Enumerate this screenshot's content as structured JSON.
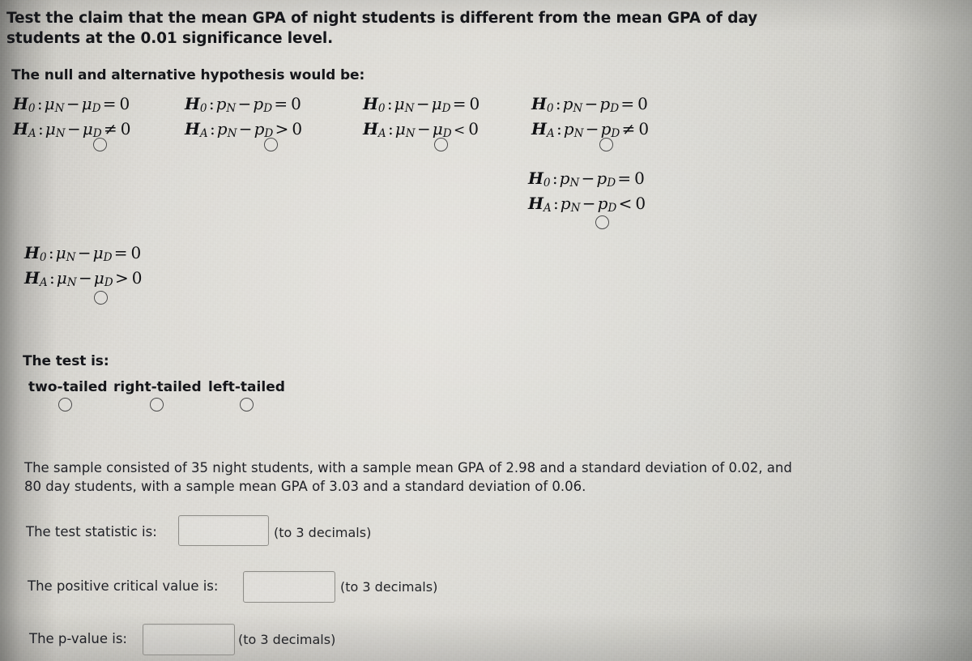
{
  "question": {
    "headline": "Test the claim that the mean GPA of night students is different from the mean GPA of day students at the 0.01 significance level.",
    "hypothesis_prompt": "The null and alternative hypothesis would be:"
  },
  "hypothesis_options": [
    {
      "id": "opt-1",
      "null_h": "H0 : μN − μD = 0",
      "alt_h": "HA : μN − μD ≠ 0",
      "null_left": "H",
      "null_sub": "0",
      "null_param_a": "μ",
      "null_sub_a": "N",
      "null_param_b": "μ",
      "null_sub_b": "D",
      "null_rel": "=",
      "null_value": "0",
      "alt_left": "H",
      "alt_sub": "A",
      "alt_param_a": "μ",
      "alt_sub_a": "N",
      "alt_param_b": "μ",
      "alt_sub_b": "D",
      "alt_rel": "≠",
      "alt_value": "0",
      "selected": false
    },
    {
      "id": "opt-2",
      "null_h": "H0 : pN − pD = 0",
      "alt_h": "HA : pN − pD > 0",
      "null_left": "H",
      "null_sub": "0",
      "null_param_a": "p",
      "null_sub_a": "N",
      "null_param_b": "p",
      "null_sub_b": "D",
      "null_rel": "=",
      "null_value": "0",
      "alt_left": "H",
      "alt_sub": "A",
      "alt_param_a": "p",
      "alt_sub_a": "N",
      "alt_param_b": "p",
      "alt_sub_b": "D",
      "alt_rel": ">",
      "alt_value": "0",
      "selected": false
    },
    {
      "id": "opt-3",
      "null_h": "H0 : μN − μD = 0",
      "alt_h": "HA : μN − μD < 0",
      "null_left": "H",
      "null_sub": "0",
      "null_param_a": "μ",
      "null_sub_a": "N",
      "null_param_b": "μ",
      "null_sub_b": "D",
      "null_rel": "=",
      "null_value": "0",
      "alt_left": "H",
      "alt_sub": "A",
      "alt_param_a": "μ",
      "alt_sub_a": "N",
      "alt_param_b": "μ",
      "alt_sub_b": "D",
      "alt_rel": "<",
      "alt_value": "0",
      "selected": false
    },
    {
      "id": "opt-4",
      "null_h": "H0 : pN − pD = 0",
      "alt_h": "HA : pN − pD ≠ 0",
      "null_left": "H",
      "null_sub": "0",
      "null_param_a": "p",
      "null_sub_a": "N",
      "null_param_b": "p",
      "null_sub_b": "D",
      "null_rel": "=",
      "null_value": "0",
      "alt_left": "H",
      "alt_sub": "A",
      "alt_param_a": "p",
      "alt_sub_a": "N",
      "alt_param_b": "p",
      "alt_sub_b": "D",
      "alt_rel": "≠",
      "alt_value": "0",
      "selected": false
    },
    {
      "id": "opt-5",
      "null_h": "H0 : pN − pD = 0",
      "alt_h": "HA : pN − pD < 0",
      "null_left": "H",
      "null_sub": "0",
      "null_param_a": "p",
      "null_sub_a": "N",
      "null_param_b": "p",
      "null_sub_b": "D",
      "null_rel": "=",
      "null_value": "0",
      "alt_left": "H",
      "alt_sub": "A",
      "alt_param_a": "p",
      "alt_sub_a": "N",
      "alt_param_b": "p",
      "alt_sub_b": "D",
      "alt_rel": "<",
      "alt_value": "0",
      "selected": false
    },
    {
      "id": "opt-6",
      "null_h": "H0 : μN − μD = 0",
      "alt_h": "HA : μN − μD > 0",
      "null_left": "H",
      "null_sub": "0",
      "null_param_a": "μ",
      "null_sub_a": "N",
      "null_param_b": "μ",
      "null_sub_b": "D",
      "null_rel": "=",
      "null_value": "0",
      "alt_left": "H",
      "alt_sub": "A",
      "alt_param_a": "μ",
      "alt_sub_a": "N",
      "alt_param_b": "μ",
      "alt_sub_b": "D",
      "alt_rel": ">",
      "alt_value": "0",
      "selected": false
    }
  ],
  "test_is": {
    "label": "The test is:",
    "options": [
      {
        "id": "two-tailed",
        "label": "two-tailed",
        "selected": false
      },
      {
        "id": "right-tailed",
        "label": "right-tailed",
        "selected": false
      },
      {
        "id": "left-tailed",
        "label": "left-tailed",
        "selected": false
      }
    ]
  },
  "sample": {
    "paragraph": "The sample consisted of 35 night students, with a sample mean GPA of 2.98 and a standard deviation of 0.02, and 80 day students, with a sample mean GPA of 3.03 and a standard deviation of 0.06.",
    "night_n": "35",
    "night_mean": "2.98",
    "night_sd": "0.02",
    "day_n": "80",
    "day_mean": "3.03",
    "day_sd": "0.06",
    "significance_level": "0.01"
  },
  "answers": [
    {
      "id": "test-statistic",
      "label": "The test statistic is:",
      "value": "",
      "placeholder": "",
      "hint": "(to 3 decimals)"
    },
    {
      "id": "positive-critical-value",
      "label": "The positive critical value is:",
      "value": "",
      "placeholder": "",
      "hint": "(to 3 decimals)"
    },
    {
      "id": "p-value",
      "label": "The p-value is:",
      "value": "",
      "placeholder": "",
      "hint": "(to 3 decimals)"
    }
  ],
  "colors": {
    "page_background": "#d6d4ce",
    "text": "#15161a",
    "field_border": "#8e8d88",
    "radio_border": "#4a4a4a"
  }
}
